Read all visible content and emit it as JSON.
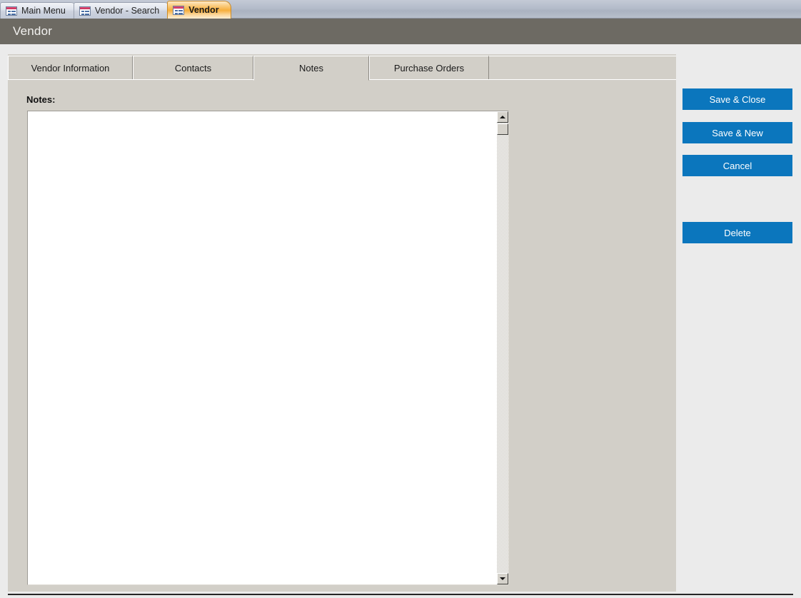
{
  "window": {
    "document_tabs": [
      {
        "label": "Main Menu",
        "icon": "form-icon",
        "active": false
      },
      {
        "label": "Vendor - Search",
        "icon": "form-icon",
        "active": false
      },
      {
        "label": "Vendor",
        "icon": "form-icon",
        "active": true
      }
    ]
  },
  "header": {
    "title": "Vendor"
  },
  "tab_control": {
    "tabs": [
      {
        "label": "Vendor Information",
        "active": false
      },
      {
        "label": "Contacts",
        "active": false
      },
      {
        "label": "Notes",
        "active": true
      },
      {
        "label": "Purchase Orders",
        "active": false
      }
    ]
  },
  "notes_page": {
    "label": "Notes:",
    "value": "",
    "placeholder": "",
    "scrollbar": {
      "up_arrow": "scroll-up-icon",
      "down_arrow": "scroll-down-icon"
    }
  },
  "actions": {
    "save_close": "Save & Close",
    "save_new": "Save & New",
    "cancel": "Cancel",
    "delete": "Delete"
  },
  "colors": {
    "accent_button": "#0b76bd",
    "header_bar": "#6d6a63",
    "panel_background": "#d2cfc8",
    "app_background": "#ebebeb",
    "active_doc_tab": "#f6ae3c"
  }
}
